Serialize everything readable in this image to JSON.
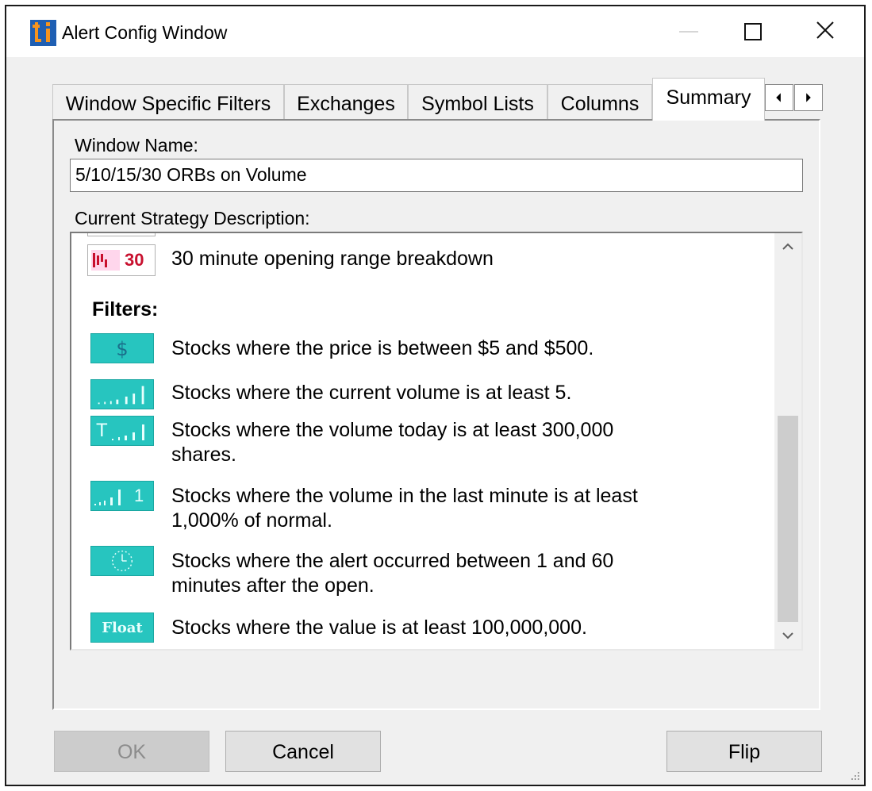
{
  "window": {
    "title": "Alert Config Window",
    "logo_text": "ti",
    "colors": {
      "logo_blue": "#1f5fb3",
      "logo_orange": "#f7941d",
      "teal": "#27c5bf",
      "alert_red": "#c8102e"
    }
  },
  "tabs": [
    {
      "label": "Window Specific Filters",
      "active": false
    },
    {
      "label": "Exchanges",
      "active": false
    },
    {
      "label": "Symbol Lists",
      "active": false
    },
    {
      "label": "Columns",
      "active": false
    },
    {
      "label": "Summary",
      "active": true
    }
  ],
  "summary": {
    "window_name_label": "Window Name:",
    "window_name_value": "5/10/15/30 ORBs on Volume",
    "strategy_label": "Current Strategy Description:",
    "alert": {
      "icon_text": "30",
      "text": "30 minute opening range breakdown"
    },
    "filters_heading": "Filters:",
    "filters": [
      {
        "icon": "dollar-icon",
        "text": [
          "Stocks where the price is between $5 and $500."
        ]
      },
      {
        "icon": "volume-bars-icon",
        "text": [
          "Stocks where the current volume is at least 5."
        ]
      },
      {
        "icon": "volume-today-icon",
        "icon_text": "T",
        "text": [
          "Stocks where the volume today is at least 300,000",
          "shares."
        ]
      },
      {
        "icon": "volume-1min-icon",
        "icon_text": "1",
        "text": [
          "Stocks where the volume in the last minute is at least",
          "1,000% of normal."
        ]
      },
      {
        "icon": "clock-icon",
        "text": [
          "Stocks where the alert occurred between 1 and 60",
          "minutes after the open."
        ]
      },
      {
        "icon": "float-icon",
        "icon_text": "Float",
        "text": [
          "Stocks where the value is at least 100,000,000."
        ]
      }
    ]
  },
  "buttons": {
    "ok": "OK",
    "cancel": "Cancel",
    "flip": "Flip"
  }
}
